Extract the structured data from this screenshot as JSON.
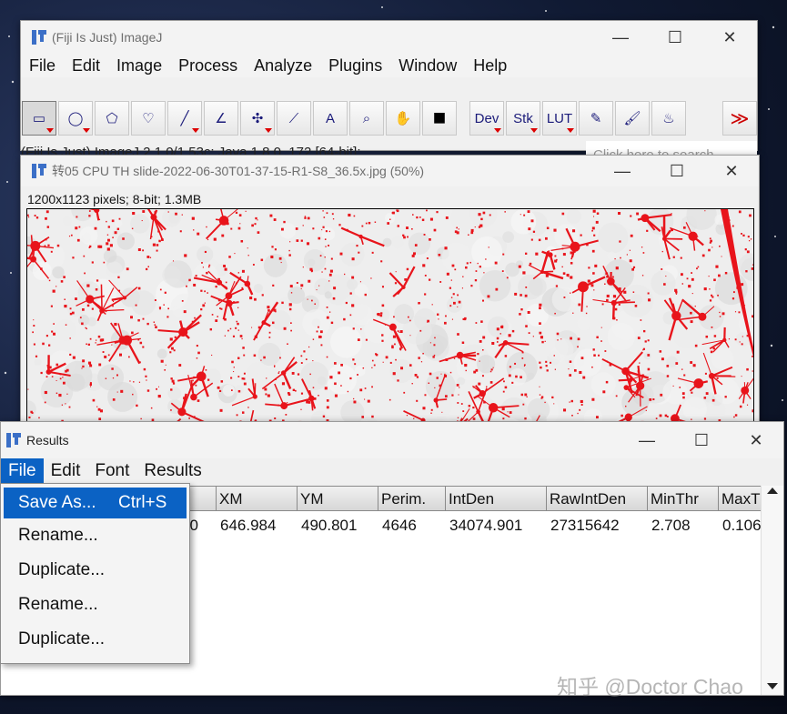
{
  "imagej_window": {
    "title": "(Fiji Is Just) ImageJ",
    "menu": [
      "File",
      "Edit",
      "Image",
      "Process",
      "Analyze",
      "Plugins",
      "Window",
      "Help"
    ],
    "tools": [
      {
        "name": "rectangle-tool-icon",
        "glyph": "▭"
      },
      {
        "name": "oval-tool-icon",
        "glyph": "◯"
      },
      {
        "name": "polygon-tool-icon",
        "glyph": "⬠"
      },
      {
        "name": "freehand-tool-icon",
        "glyph": "♡"
      },
      {
        "name": "line-tool-icon",
        "glyph": "╱"
      },
      {
        "name": "angle-tool-icon",
        "glyph": "∠"
      },
      {
        "name": "multipoint-tool-icon",
        "glyph": "✣"
      },
      {
        "name": "wand-tool-icon",
        "glyph": "⟋"
      },
      {
        "name": "text-tool-icon",
        "glyph": "A"
      },
      {
        "name": "magnifier-tool-icon",
        "glyph": "⌕"
      },
      {
        "name": "hand-tool-icon",
        "glyph": "✋"
      },
      {
        "name": "color-picker-tool-icon",
        "glyph": "■"
      },
      {
        "name": "dev-tool",
        "glyph": "Dev"
      },
      {
        "name": "stk-tool",
        "glyph": "Stk"
      },
      {
        "name": "lut-tool",
        "glyph": "LUT"
      },
      {
        "name": "pencil-tool-icon",
        "glyph": "✎"
      },
      {
        "name": "brush-tool-icon",
        "glyph": "🖌"
      },
      {
        "name": "flood-fill-tool-icon",
        "glyph": "♨"
      },
      {
        "name": "more-tools-icon",
        "glyph": "≫"
      }
    ],
    "status": "(Fiji Is Just) ImageJ 2.1.0/1.53c; Java 1.8.0_172 [64-bit];",
    "search_placeholder": "Click here to search"
  },
  "image_window": {
    "title": "转05 CPU TH slide-2022-06-30T01-37-15-R1-S8_36.5x.jpg (50%)",
    "info": "1200x1123 pixels; 8-bit; 1.3MB"
  },
  "results_window": {
    "title": "Results",
    "menu": [
      "File",
      "Edit",
      "Font",
      "Results"
    ],
    "columns": [
      "",
      "XM",
      "YM",
      "Perim.",
      "IntDen",
      "RawIntDen",
      "MinThr",
      "MaxTl"
    ],
    "rows": [
      [
        "0",
        "646.984",
        "490.801",
        "4646",
        "34074.901",
        "27315642",
        "2.708",
        "0.106"
      ]
    ]
  },
  "file_menu": {
    "items": [
      {
        "label": "Save As...",
        "shortcut": "Ctrl+S"
      },
      {
        "label": "Rename...",
        "shortcut": ""
      },
      {
        "label": "Duplicate...",
        "shortcut": ""
      },
      {
        "label": "Rename...",
        "shortcut": ""
      },
      {
        "label": "Duplicate...",
        "shortcut": ""
      }
    ]
  },
  "window_controls": {
    "minimize": "—",
    "maximize": "☐",
    "close": "✕"
  },
  "watermark": "知乎 @Doctor Chao",
  "colors": {
    "accent": "#0b62c4",
    "stain": "#e8141b",
    "titlebar": "#f3f3f3"
  }
}
